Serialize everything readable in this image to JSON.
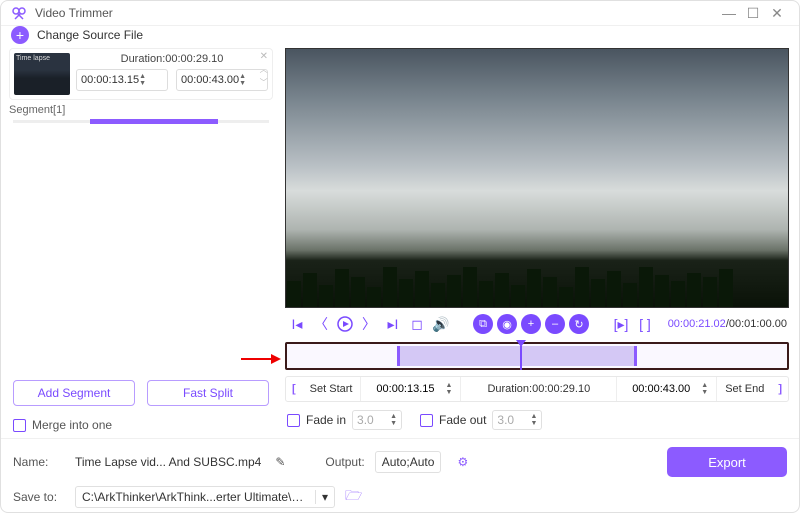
{
  "window": {
    "title": "Video Trimmer"
  },
  "topbar": {
    "change_source": "Change Source File"
  },
  "segment": {
    "thumb_caption": "Time lapse",
    "duration_label": "Duration:00:00:29.10",
    "start": "00:00:13.15",
    "end": "00:00:43.00",
    "tag": "Segment[1]"
  },
  "left_buttons": {
    "add": "Add Segment",
    "split": "Fast Split"
  },
  "merge": {
    "label": "Merge into one"
  },
  "playback": {
    "current": "00:00:21.02",
    "total": "00:01:00.00"
  },
  "setrow": {
    "set_start": "Set Start",
    "start_val": "00:00:13.15",
    "duration": "Duration:00:00:29.10",
    "end_val": "00:00:43.00",
    "set_end": "Set End"
  },
  "fade": {
    "in_label": "Fade in",
    "in_val": "3.0",
    "out_label": "Fade out",
    "out_val": "3.0"
  },
  "footer": {
    "name_label": "Name:",
    "name_value": "Time Lapse vid... And SUBSC.mp4",
    "output_label": "Output:",
    "output_value": "Auto;Auto",
    "save_label": "Save to:",
    "save_path": "C:\\ArkThinker\\ArkThink...erter Ultimate\\Trimmer",
    "export": "Export"
  }
}
